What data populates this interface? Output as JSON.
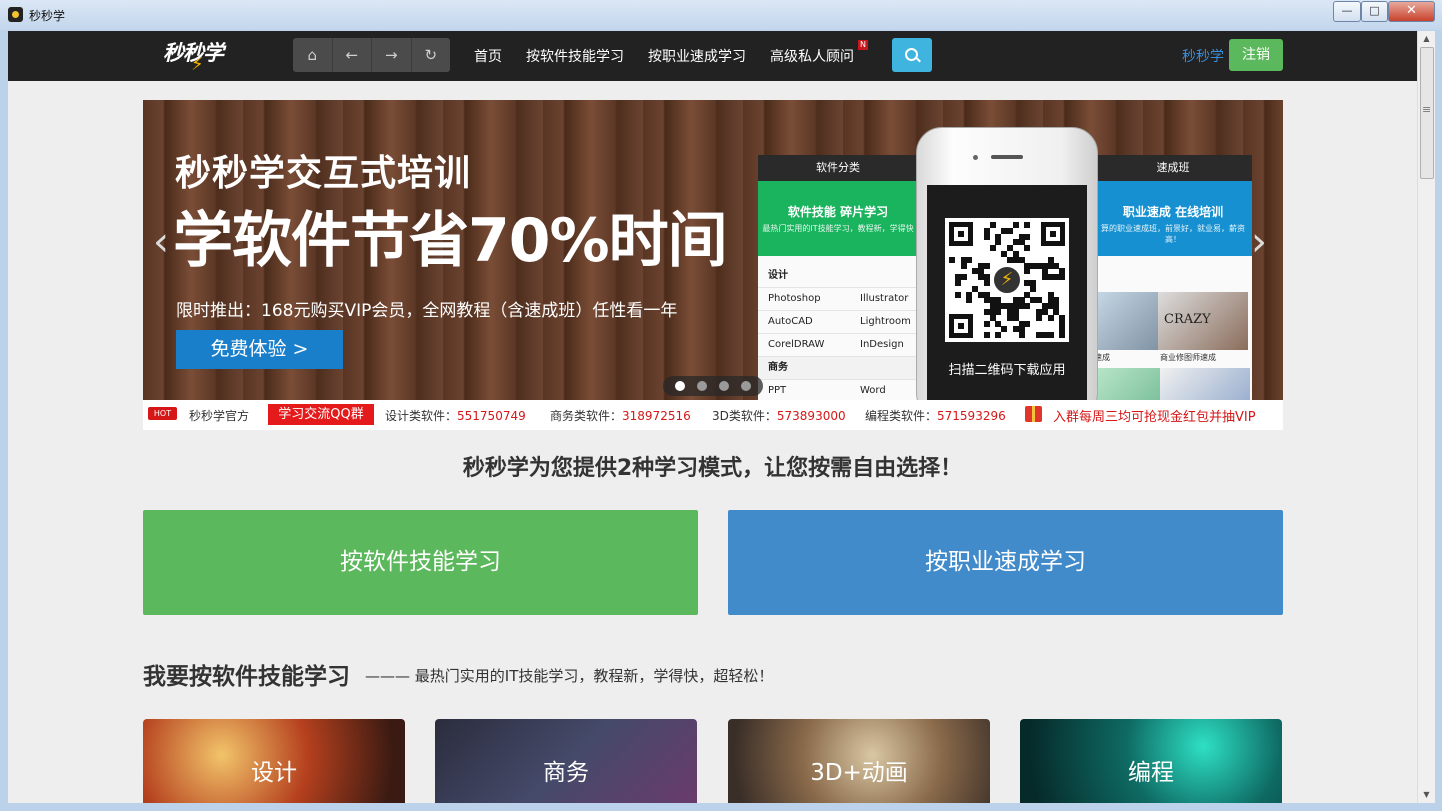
{
  "window": {
    "title": "秒秒学",
    "min": "—",
    "max": "□",
    "close": "✕"
  },
  "nav": {
    "logo": "秒秒学",
    "home_icon": "home-icon",
    "back_icon": "back-arrow-icon",
    "forward_icon": "forward-arrow-icon",
    "refresh_icon": "refresh-icon",
    "links": [
      "首页",
      "按软件技能学习",
      "按职业速成学习",
      "高级私人顾问"
    ],
    "new_badge": "N",
    "username": "秒秒学",
    "logout": "注销"
  },
  "banner": {
    "headline1": "秒秒学交互式培训",
    "headline2": "学软件节省70%时间",
    "promo": "限时推出：168元购买VIP会员，全网教程（含速成班）任性看一年",
    "try_button": "免费体验 >",
    "app": {
      "tab_left": "软件分类",
      "tab_right": "速成班",
      "green_title": "软件技能 碎片学习",
      "green_sub": "最热门实用的IT技能学习，教程新，学得快",
      "blue_title": "职业速成 在线培训",
      "blue_sub": "算的职业速成班，前景好，就业易，薪资高！",
      "cat_design": "设计",
      "list": [
        [
          "Photoshop",
          "Illustrator"
        ],
        [
          "AutoCAD",
          "Lightroom"
        ],
        [
          "CorelDRAW",
          "InDesign"
        ]
      ],
      "cat_business": "商务",
      "list2": [
        "PPT",
        "Word"
      ],
      "thumb_caption1": "速成",
      "thumb_caption2": "商业修图师速成",
      "thumb_text": "CRAZY"
    },
    "qr_caption": "扫描二维码下载应用",
    "slides": 4,
    "active_slide": 1
  },
  "strip": {
    "hot": "HOT",
    "official": "秒秒学官方",
    "qq_tag": "学习交流QQ群",
    "groups": [
      {
        "label": "设计类软件：",
        "num": "551750749"
      },
      {
        "label": "商务类软件：",
        "num": "318972516"
      },
      {
        "label": "3D类软件：",
        "num": "573893000"
      },
      {
        "label": "编程类软件：",
        "num": "571593296"
      }
    ],
    "gift_text": "入群每周三均可抢现金红包并抽VIP"
  },
  "tagline": "秒秒学为您提供2种学习模式，让您按需自由选择！",
  "modes": [
    "按软件技能学习",
    "按职业速成学习"
  ],
  "section": {
    "title": "我要按软件技能学习",
    "subtitle": "——— 最热门实用的IT技能学习，教程新，学得快，超轻松！"
  },
  "cards": [
    "设计",
    "商务",
    "3D+动画",
    "编程"
  ],
  "colors": {
    "nav_bg": "#222222",
    "green": "#5cb85c",
    "blue": "#428bca",
    "accent_red": "#d51717",
    "search": "#3fb4df"
  }
}
